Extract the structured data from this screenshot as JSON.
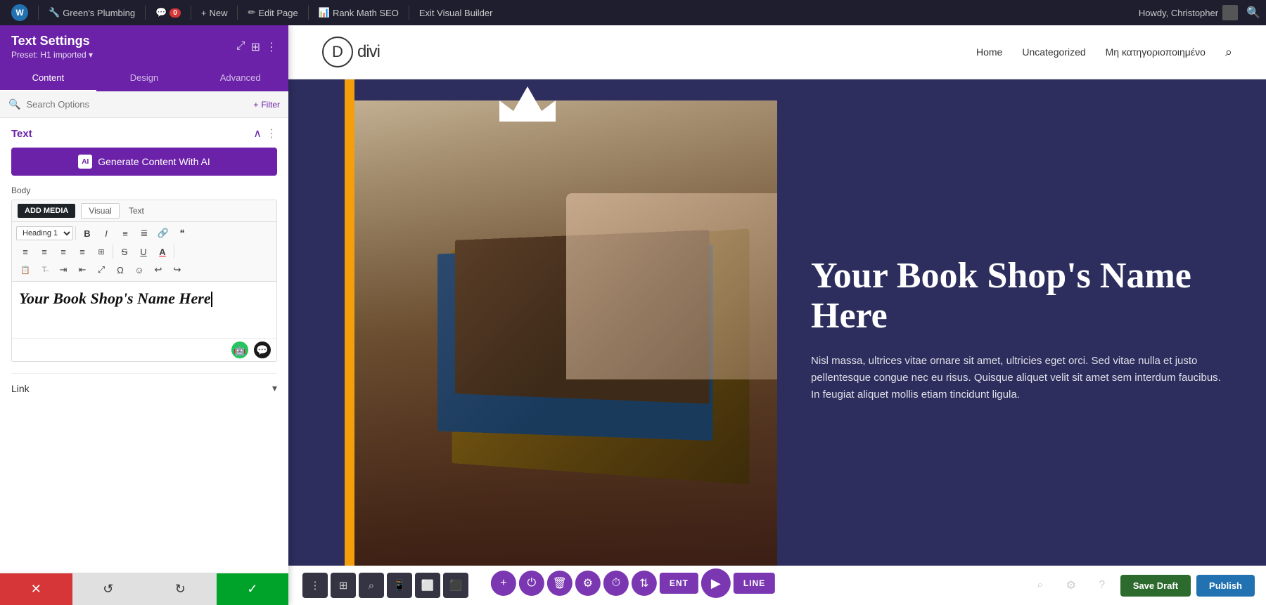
{
  "adminBar": {
    "wpLogoLabel": "W",
    "siteName": "Green's Plumbing",
    "comments": "0",
    "new": "New",
    "editPage": "Edit Page",
    "rankMath": "Rank Math SEO",
    "exitBuilder": "Exit Visual Builder",
    "howdy": "Howdy, Christopher"
  },
  "leftPanel": {
    "title": "Text Settings",
    "preset": "Preset: H1 imported ▾",
    "tabs": [
      "Content",
      "Design",
      "Advanced"
    ],
    "activeTab": "Content",
    "searchPlaceholder": "Search Options",
    "filterLabel": "+ Filter",
    "sections": {
      "text": {
        "label": "Text",
        "aiButton": "Generate Content With AI",
        "aiIconLabel": "AI",
        "bodyLabel": "Body",
        "addMediaBtn": "ADD MEDIA",
        "viewTabs": [
          "Visual",
          "Text"
        ],
        "activeViewTab": "Visual",
        "headingSelect": "Heading 1",
        "editorContent": "Your Book Shop's Name Here",
        "linkLabel": "Link",
        "linkArrow": "▾"
      }
    },
    "bottomBar": {
      "cancelIcon": "✕",
      "undoIcon": "↺",
      "redoIcon": "↻",
      "confirmIcon": "✓"
    }
  },
  "siteHeader": {
    "logoD": "D",
    "logoText": "divi",
    "nav": [
      "Home",
      "Uncategorized",
      "Μη κατηγοριοποιημένο"
    ],
    "searchIcon": "⌕"
  },
  "hero": {
    "heading": "Your Book Shop's Name Here",
    "bodyText": "Nisl massa, ultrices vitae ornare sit amet, ultricies eget orci. Sed vitae nulla et justo pellentesque congue nec eu risus. Quisque aliquet velit sit amet sem interdum faucibus. In feugiat aliquet mollis etiam tincidunt ligula."
  },
  "moduleControls": {
    "addIcon": "+",
    "powerIcon": "⏻",
    "deleteIcon": "🗑",
    "settingsIcon": "⚙",
    "historyIcon": "⏱",
    "sortIcon": "⇅",
    "navIcon": "▶",
    "closeIcon": "✕"
  },
  "canvasTools": {
    "menuIcon": "⋮",
    "gridIcon": "⊞",
    "searchIcon": "⌕",
    "mobileIcon": "📱",
    "tabletIcon": "⬜",
    "desktopIcon": "⬛"
  },
  "saveArea": {
    "searchIcon": "⌕",
    "settingsIcon": "⚙",
    "helpIcon": "?",
    "saveDraft": "Save Draft",
    "publish": "Publish"
  },
  "formatToolbar": {
    "bold": "B",
    "italic": "I",
    "unorderedList": "≡",
    "orderedList": "≣",
    "link": "🔗",
    "quote": "❝",
    "alignLeft": "≡",
    "alignCenter": "≡",
    "alignRight": "≡",
    "alignJustify": "≡",
    "table": "⊞",
    "strikethrough": "S",
    "underline": "U",
    "colorA": "A",
    "paste": "📋",
    "clear": "T",
    "indent": "⇥",
    "outdent": "⇤",
    "expand": "⤢",
    "special": "Ω",
    "emoji": "☺",
    "undo2": "↩",
    "redo2": "↪"
  },
  "colors": {
    "purple": "#6b21a8",
    "purpleLight": "#7c3aed",
    "heroBackground": "#2d2d5e",
    "yellow": "#f59e0b",
    "adminBarBg": "#1e1e2e"
  }
}
